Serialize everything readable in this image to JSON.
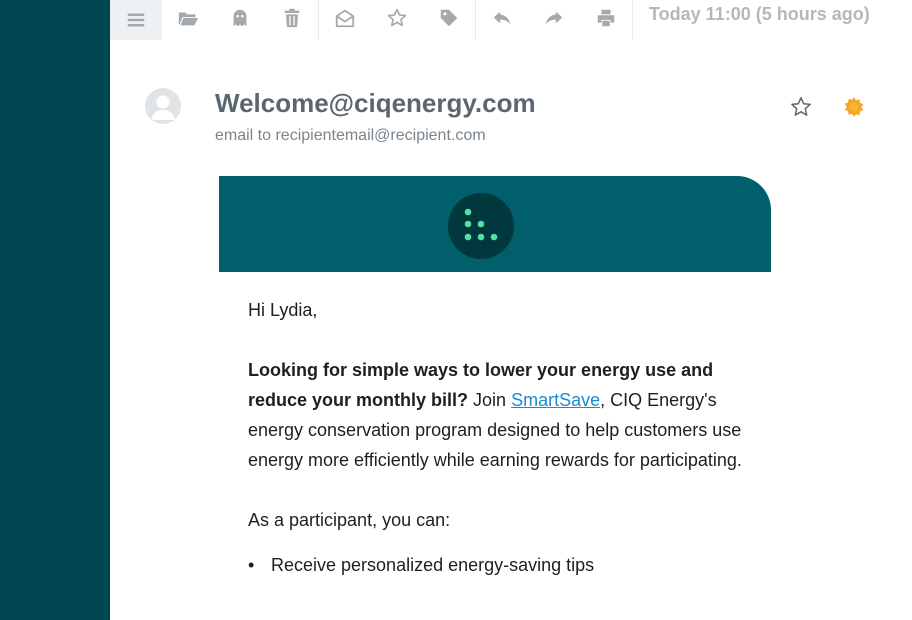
{
  "toolbar": {
    "date_text": "Today 11:00 (5 hours ago)"
  },
  "email": {
    "sender": "Welcome@ciqenergy.com",
    "recipient_line": "email to recipientemail@recipient.com"
  },
  "body": {
    "greeting": "Hi Lydia,",
    "lead_bold": "Looking for simple ways to lower your energy use and reduce your monthly bill?",
    "join_text": "Join",
    "program_link": "SmartSave",
    "program_desc": ", CIQ Energy's energy conservation program designed to help customers use energy more efficiently while earning rewards for participating.",
    "participant_intro": "As a participant, you can:",
    "bullets": [
      "Receive personalized energy-saving tips"
    ]
  },
  "colors": {
    "sidebar": "#004650",
    "banner": "#005f6b",
    "logo_bg": "#01383e",
    "logo_dots": "#54e2a4",
    "link": "#1a8ad4",
    "sun": "#f5a623"
  }
}
